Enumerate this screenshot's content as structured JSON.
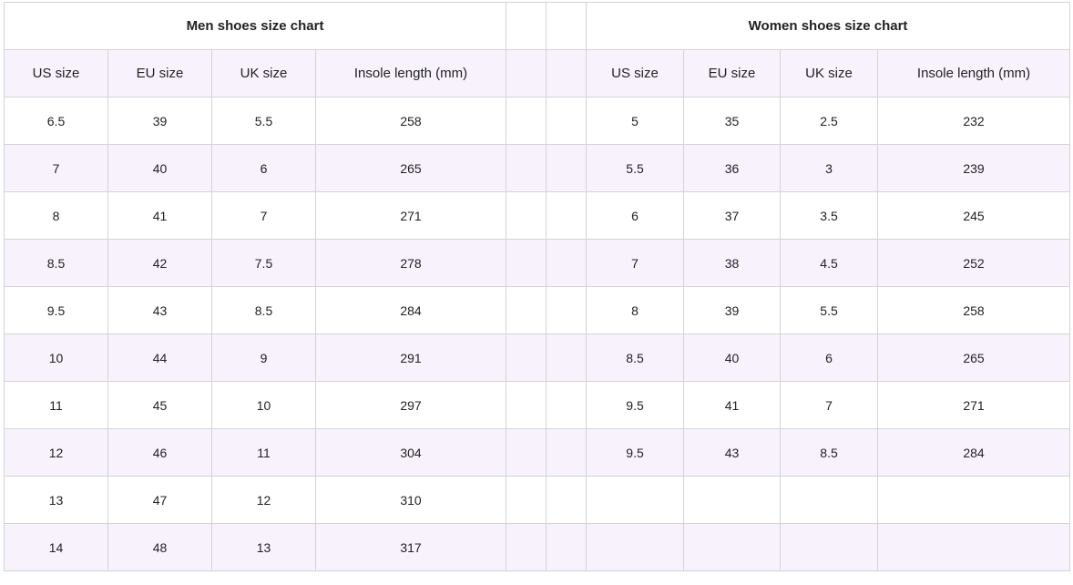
{
  "men": {
    "title": "Men shoes size chart",
    "headers": [
      "US size",
      "EU size",
      "UK size",
      "Insole length (mm)"
    ],
    "rows": [
      [
        "6.5",
        "39",
        "5.5",
        "258"
      ],
      [
        "7",
        "40",
        "6",
        "265"
      ],
      [
        "8",
        "41",
        "7",
        "271"
      ],
      [
        "8.5",
        "42",
        "7.5",
        "278"
      ],
      [
        "9.5",
        "43",
        "8.5",
        "284"
      ],
      [
        "10",
        "44",
        "9",
        "291"
      ],
      [
        "11",
        "45",
        "10",
        "297"
      ],
      [
        "12",
        "46",
        "11",
        "304"
      ],
      [
        "13",
        "47",
        "12",
        "310"
      ],
      [
        "14",
        "48",
        "13",
        "317"
      ]
    ]
  },
  "women": {
    "title": "Women shoes size chart",
    "headers": [
      "US size",
      "EU size",
      "UK size",
      "Insole length (mm)"
    ],
    "rows": [
      [
        "5",
        "35",
        "2.5",
        "232"
      ],
      [
        "5.5",
        "36",
        "3",
        "239"
      ],
      [
        "6",
        "37",
        "3.5",
        "245"
      ],
      [
        "7",
        "38",
        "4.5",
        "252"
      ],
      [
        "8",
        "39",
        "5.5",
        "258"
      ],
      [
        "8.5",
        "40",
        "6",
        "265"
      ],
      [
        "9.5",
        "41",
        "7",
        "271"
      ],
      [
        "9.5",
        "43",
        "8.5",
        "284"
      ]
    ]
  },
  "colors": {
    "stripe": "#f8f2fd",
    "border": "#d4d4d8",
    "text": "#222222"
  }
}
